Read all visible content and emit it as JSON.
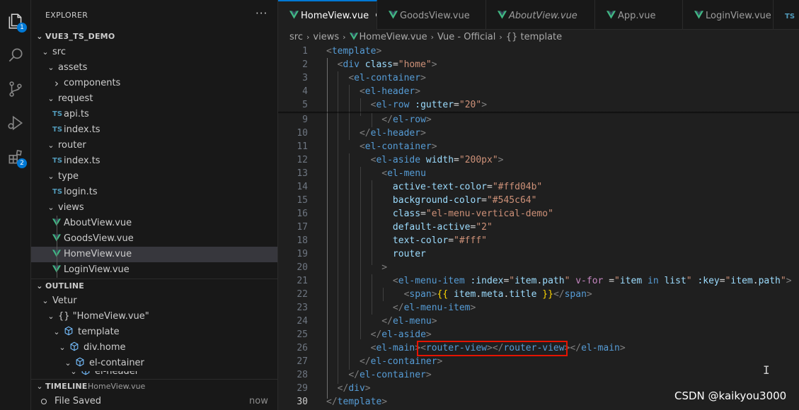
{
  "activity_bar": {
    "explorer_badge": "1",
    "extensions_badge": "2",
    "icons": [
      "files-icon",
      "search-icon",
      "source-control-icon",
      "run-debug-icon",
      "extensions-icon"
    ]
  },
  "sidebar": {
    "title": "EXPLORER",
    "more": "···",
    "project": "VUE3_TS_DEMO",
    "tree": [
      {
        "label": "src",
        "type": "folder"
      },
      {
        "label": "assets",
        "type": "folder"
      },
      {
        "label": "components",
        "type": "folder-collapsed"
      },
      {
        "label": "request",
        "type": "folder"
      },
      {
        "label": "api.ts",
        "type": "ts"
      },
      {
        "label": "index.ts",
        "type": "ts"
      },
      {
        "label": "router",
        "type": "folder"
      },
      {
        "label": "index.ts",
        "type": "ts"
      },
      {
        "label": "type",
        "type": "folder"
      },
      {
        "label": "login.ts",
        "type": "ts"
      },
      {
        "label": "views",
        "type": "folder"
      },
      {
        "label": "AboutView.vue",
        "type": "vue"
      },
      {
        "label": "GoodsView.vue",
        "type": "vue"
      },
      {
        "label": "HomeView.vue",
        "type": "vue",
        "selected": true
      },
      {
        "label": "LoginView.vue",
        "type": "vue"
      }
    ],
    "outline": {
      "title": "OUTLINE",
      "items": [
        "Vetur",
        "{} \"HomeView.vue\"",
        "template",
        "div.home",
        "el-container",
        "el-header"
      ]
    },
    "timeline": {
      "title": "TIMELINE",
      "file": "HomeView.vue",
      "entry": "File Saved",
      "time": "now"
    },
    "ts_label": "TS"
  },
  "tabs": [
    {
      "label": "HomeView.vue",
      "active": true,
      "dirty": true
    },
    {
      "label": "GoodsView.vue"
    },
    {
      "label": "AboutView.vue",
      "italic": true
    },
    {
      "label": "App.vue"
    },
    {
      "label": "LoginView.vue"
    },
    {
      "label": "TS"
    }
  ],
  "breadcrumb": [
    "src",
    "views",
    "HomeView.vue",
    "Vue - Official",
    "{} template"
  ],
  "code": {
    "current_line": "30",
    "lines": [
      {
        "n": "1",
        "tokens": [
          [
            "b",
            "<"
          ],
          [
            "t",
            "template"
          ],
          [
            "b",
            ">"
          ]
        ]
      },
      {
        "n": "2",
        "tokens": [
          [
            "p",
            "  "
          ],
          [
            "b",
            "<"
          ],
          [
            "t",
            "div"
          ],
          [
            "p",
            " "
          ],
          [
            "a",
            "class"
          ],
          [
            "p",
            "="
          ],
          [
            "s",
            "\"home\""
          ],
          [
            "b",
            ">"
          ]
        ]
      },
      {
        "n": "3",
        "tokens": [
          [
            "p",
            "    "
          ],
          [
            "b",
            "<"
          ],
          [
            "t",
            "el-container"
          ],
          [
            "b",
            ">"
          ]
        ]
      },
      {
        "n": "4",
        "tokens": [
          [
            "p",
            "      "
          ],
          [
            "b",
            "<"
          ],
          [
            "t",
            "el-header"
          ],
          [
            "b",
            ">"
          ]
        ]
      },
      {
        "n": "5",
        "tokens": [
          [
            "p",
            "        "
          ],
          [
            "b",
            "<"
          ],
          [
            "t",
            "el-row"
          ],
          [
            "p",
            " "
          ],
          [
            "a",
            ":gutter"
          ],
          [
            "p",
            "="
          ],
          [
            "s",
            "\"20\""
          ],
          [
            "b",
            ">"
          ]
        ]
      },
      {
        "n": "9",
        "tokens": [
          [
            "p",
            "          "
          ],
          [
            "b",
            "</"
          ],
          [
            "t",
            "el-row"
          ],
          [
            "b",
            ">"
          ]
        ]
      },
      {
        "n": "10",
        "tokens": [
          [
            "p",
            "      "
          ],
          [
            "b",
            "</"
          ],
          [
            "t",
            "el-header"
          ],
          [
            "b",
            ">"
          ]
        ]
      },
      {
        "n": "11",
        "tokens": [
          [
            "p",
            "      "
          ],
          [
            "b",
            "<"
          ],
          [
            "t",
            "el-container"
          ],
          [
            "b",
            ">"
          ]
        ]
      },
      {
        "n": "12",
        "tokens": [
          [
            "p",
            "        "
          ],
          [
            "b",
            "<"
          ],
          [
            "t",
            "el-aside"
          ],
          [
            "p",
            " "
          ],
          [
            "a",
            "width"
          ],
          [
            "p",
            "="
          ],
          [
            "s",
            "\"200px\""
          ],
          [
            "b",
            ">"
          ]
        ]
      },
      {
        "n": "13",
        "tokens": [
          [
            "p",
            "          "
          ],
          [
            "b",
            "<"
          ],
          [
            "t",
            "el-menu"
          ]
        ]
      },
      {
        "n": "14",
        "tokens": [
          [
            "p",
            "            "
          ],
          [
            "a",
            "active-text-color"
          ],
          [
            "p",
            "="
          ],
          [
            "s",
            "\"#ffd04b\""
          ]
        ]
      },
      {
        "n": "15",
        "tokens": [
          [
            "p",
            "            "
          ],
          [
            "a",
            "background-color"
          ],
          [
            "p",
            "="
          ],
          [
            "s",
            "\"#545c64\""
          ]
        ]
      },
      {
        "n": "16",
        "tokens": [
          [
            "p",
            "            "
          ],
          [
            "a",
            "class"
          ],
          [
            "p",
            "="
          ],
          [
            "s",
            "\"el-menu-vertical-demo\""
          ]
        ]
      },
      {
        "n": "17",
        "tokens": [
          [
            "p",
            "            "
          ],
          [
            "a",
            "default-active"
          ],
          [
            "p",
            "="
          ],
          [
            "s",
            "\"2\""
          ]
        ]
      },
      {
        "n": "18",
        "tokens": [
          [
            "p",
            "            "
          ],
          [
            "a",
            "text-color"
          ],
          [
            "p",
            "="
          ],
          [
            "s",
            "\"#fff\""
          ]
        ]
      },
      {
        "n": "19",
        "tokens": [
          [
            "p",
            "            "
          ],
          [
            "a",
            "router"
          ]
        ]
      },
      {
        "n": "20",
        "tokens": [
          [
            "p",
            "          "
          ],
          [
            "b",
            ">"
          ]
        ]
      },
      {
        "n": "21",
        "tokens": [
          [
            "p",
            "            "
          ],
          [
            "b",
            "<"
          ],
          [
            "t",
            "el-menu-item"
          ],
          [
            "p",
            " "
          ],
          [
            "a",
            ":index"
          ],
          [
            "p",
            "="
          ],
          [
            "s",
            "\""
          ],
          [
            "a",
            "item"
          ],
          [
            "p",
            "."
          ],
          [
            "a",
            "path"
          ],
          [
            "s",
            "\""
          ],
          [
            "p",
            " "
          ],
          [
            "k",
            "v-for"
          ],
          [
            "p",
            " ="
          ],
          [
            "s",
            "\""
          ],
          [
            "a",
            "item"
          ],
          [
            "p",
            " "
          ],
          [
            "t",
            "in"
          ],
          [
            "p",
            " "
          ],
          [
            "a",
            "list"
          ],
          [
            "s",
            "\""
          ],
          [
            "p",
            " "
          ],
          [
            "a",
            ":key"
          ],
          [
            "p",
            "="
          ],
          [
            "s",
            "\""
          ],
          [
            "a",
            "item"
          ],
          [
            "p",
            "."
          ],
          [
            "a",
            "path"
          ],
          [
            "s",
            "\""
          ],
          [
            "b",
            ">"
          ]
        ]
      },
      {
        "n": "22",
        "tokens": [
          [
            "p",
            "              "
          ],
          [
            "b",
            "<"
          ],
          [
            "t",
            "span"
          ],
          [
            "b",
            ">"
          ],
          [
            "y",
            "{{"
          ],
          [
            "p",
            " "
          ],
          [
            "a",
            "item"
          ],
          [
            "p",
            "."
          ],
          [
            "a",
            "meta"
          ],
          [
            "p",
            "."
          ],
          [
            "a",
            "title"
          ],
          [
            "p",
            " "
          ],
          [
            "y",
            "}}"
          ],
          [
            "b",
            "</"
          ],
          [
            "t",
            "span"
          ],
          [
            "b",
            ">"
          ]
        ]
      },
      {
        "n": "23",
        "tokens": [
          [
            "p",
            "            "
          ],
          [
            "b",
            "</"
          ],
          [
            "t",
            "el-menu-item"
          ],
          [
            "b",
            ">"
          ]
        ]
      },
      {
        "n": "24",
        "tokens": [
          [
            "p",
            "          "
          ],
          [
            "b",
            "</"
          ],
          [
            "t",
            "el-menu"
          ],
          [
            "b",
            ">"
          ]
        ]
      },
      {
        "n": "25",
        "tokens": [
          [
            "p",
            "        "
          ],
          [
            "b",
            "</"
          ],
          [
            "t",
            "el-aside"
          ],
          [
            "b",
            ">"
          ]
        ]
      },
      {
        "n": "26",
        "tokens": [
          [
            "p",
            "        "
          ],
          [
            "b",
            "<"
          ],
          [
            "t",
            "el-main"
          ],
          [
            "b",
            ">"
          ],
          [
            "b",
            "<"
          ],
          [
            "t",
            "router-view"
          ],
          [
            "b",
            ">"
          ],
          [
            "b",
            "</"
          ],
          [
            "t",
            "router-view"
          ],
          [
            "b",
            ">"
          ],
          [
            "b",
            "</"
          ],
          [
            "t",
            "el-main"
          ],
          [
            "b",
            ">"
          ]
        ]
      },
      {
        "n": "27",
        "tokens": [
          [
            "p",
            "      "
          ],
          [
            "b",
            "</"
          ],
          [
            "t",
            "el-container"
          ],
          [
            "b",
            ">"
          ]
        ]
      },
      {
        "n": "28",
        "tokens": [
          [
            "p",
            "    "
          ],
          [
            "b",
            "</"
          ],
          [
            "t",
            "el-container"
          ],
          [
            "b",
            ">"
          ]
        ]
      },
      {
        "n": "29",
        "tokens": [
          [
            "p",
            "  "
          ],
          [
            "b",
            "</"
          ],
          [
            "t",
            "div"
          ],
          [
            "b",
            ">"
          ]
        ]
      },
      {
        "n": "30",
        "tokens": [
          [
            "b",
            "</"
          ],
          [
            "t",
            "template"
          ],
          [
            "b",
            ">"
          ]
        ]
      }
    ]
  },
  "watermark": "CSDN @kaikyou3000",
  "colors": {
    "accent": "#0078d4",
    "highlight_box": "#e51400",
    "vue_green": "#41b883",
    "ts_blue": "#519aba"
  }
}
